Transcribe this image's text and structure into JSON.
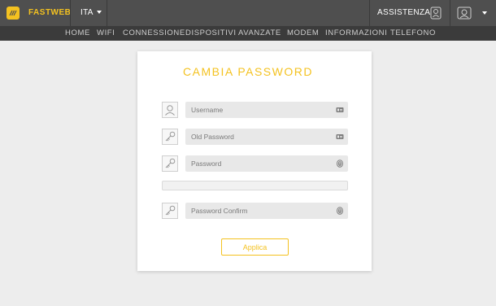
{
  "header": {
    "brand": "FASTWEB",
    "language": "ITA",
    "assistance": "ASSISTENZA"
  },
  "nav": {
    "items": [
      "HOME",
      "WIFI",
      "CONNESSIONE",
      "DISPOSITIVI",
      "AVANZATE",
      "MODEM",
      "INFORMAZIONI",
      "TELEFONO"
    ]
  },
  "form": {
    "title": "CAMBIA PASSWORD",
    "username_placeholder": "Username",
    "old_password_placeholder": "Old Password",
    "password_placeholder": "Password",
    "password_confirm_placeholder": "Password Confirm",
    "strength": 0,
    "submit_label": "Applica"
  },
  "colors": {
    "accent": "#f4c220",
    "topbar": "#4f4f4f",
    "navbar": "#3b3b3b",
    "background": "#ededed"
  },
  "icons": [
    "logo-icon",
    "caret-down-icon",
    "support-agent-icon",
    "user-avatar-icon",
    "user-icon",
    "key-icon",
    "id-card-icon",
    "fingerprint-icon"
  ]
}
